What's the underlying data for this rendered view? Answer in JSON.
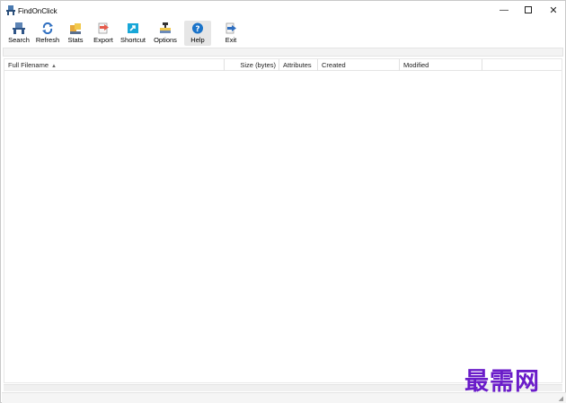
{
  "window": {
    "title": "FindOnClick",
    "minimize_glyph": "—",
    "close_glyph": "✕"
  },
  "toolbar": {
    "buttons": [
      {
        "label": "Search",
        "icon": "search-icon"
      },
      {
        "label": "Refresh",
        "icon": "refresh-icon"
      },
      {
        "label": "Stats",
        "icon": "stats-icon"
      },
      {
        "label": "Export",
        "icon": "export-icon"
      },
      {
        "label": "Shortcut",
        "icon": "shortcut-icon"
      },
      {
        "label": "Options",
        "icon": "options-icon"
      },
      {
        "label": "Help",
        "icon": "help-icon"
      },
      {
        "label": "Exit",
        "icon": "exit-icon"
      }
    ]
  },
  "list": {
    "columns": [
      {
        "label": "Full Filename",
        "sort": "ascending"
      },
      {
        "label": "Size (bytes)"
      },
      {
        "label": "Attributes"
      },
      {
        "label": "Created"
      },
      {
        "label": "Modified"
      }
    ],
    "sort_arrow": "▲",
    "rows": []
  },
  "statusbar": {
    "grip": "◢"
  },
  "watermark": {
    "text": "最需网"
  },
  "colors": {
    "help_accent": "#1a73c9",
    "watermark": "#6a1cc9"
  }
}
